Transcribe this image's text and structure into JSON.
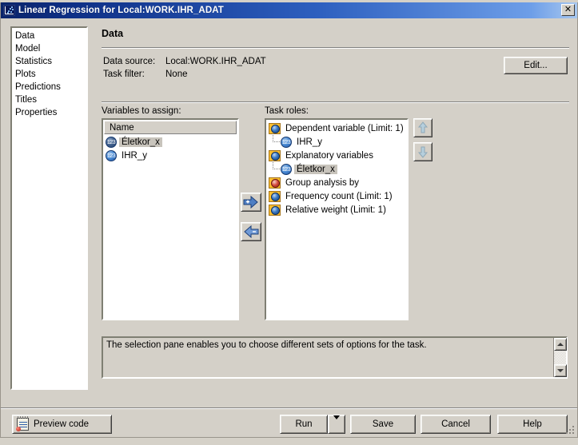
{
  "window": {
    "title": "Linear Regression for Local:WORK.IHR_ADAT",
    "title_icon": "scatter-plot-icon",
    "close_label": "✕"
  },
  "selection_pane": {
    "items": [
      {
        "label": "Data",
        "selected": true
      },
      {
        "label": "Model",
        "selected": false
      },
      {
        "label": "Statistics",
        "selected": false
      },
      {
        "label": "Plots",
        "selected": false
      },
      {
        "label": "Predictions",
        "selected": false
      },
      {
        "label": "Titles",
        "selected": false
      },
      {
        "label": "Properties",
        "selected": false
      }
    ]
  },
  "content": {
    "page_title": "Data",
    "data_source_label": "Data source:",
    "data_source_value": "Local:WORK.IHR_ADAT",
    "task_filter_label": "Task filter:",
    "task_filter_value": "None",
    "edit_button": "Edit..."
  },
  "variables": {
    "caption": "Variables to assign:",
    "column_header": "Name",
    "items": [
      {
        "name": "Életkor_x",
        "icon": "numeric-variable-icon",
        "selected": true
      },
      {
        "name": "IHR_y",
        "icon": "numeric-variable-icon",
        "selected": false
      }
    ]
  },
  "task_roles": {
    "caption": "Task roles:",
    "items": [
      {
        "label": "Dependent variable  (Limit: 1)",
        "icon": "role-globe-icon",
        "type": "role"
      },
      {
        "label": "IHR_y",
        "icon": "numeric-variable-icon",
        "type": "variable",
        "selected": false
      },
      {
        "label": "Explanatory variables",
        "icon": "role-globe-icon",
        "type": "role"
      },
      {
        "label": "Életkor_x",
        "icon": "numeric-variable-icon",
        "type": "variable",
        "selected": true
      },
      {
        "label": "Group analysis by",
        "icon": "role-group-icon",
        "type": "role"
      },
      {
        "label": "Frequency count  (Limit: 1)",
        "icon": "role-globe-icon",
        "type": "role"
      },
      {
        "label": "Relative weight  (Limit: 1)",
        "icon": "role-globe-icon",
        "type": "role"
      }
    ]
  },
  "transfer_buttons": {
    "assign": "assign-right-arrow-icon",
    "remove": "remove-left-arrow-icon",
    "move_up": "move-up-arrow-icon",
    "move_down": "move-down-arrow-icon"
  },
  "help": {
    "text": "The selection pane enables you to choose different sets of options for the task."
  },
  "footer": {
    "preview_code": "Preview code",
    "run": "Run",
    "save": "Save",
    "cancel": "Cancel",
    "help": "Help"
  },
  "colors": {
    "window_face": "#d4d0c8",
    "title_start": "#0a246a",
    "title_end": "#a8c8f0",
    "selection_highlight": "#0a246a",
    "inactive_selection": "#c8c4bc",
    "role_icon_gold": "#fcbf2e",
    "variable_icon_blue": "#1d4f9e"
  }
}
